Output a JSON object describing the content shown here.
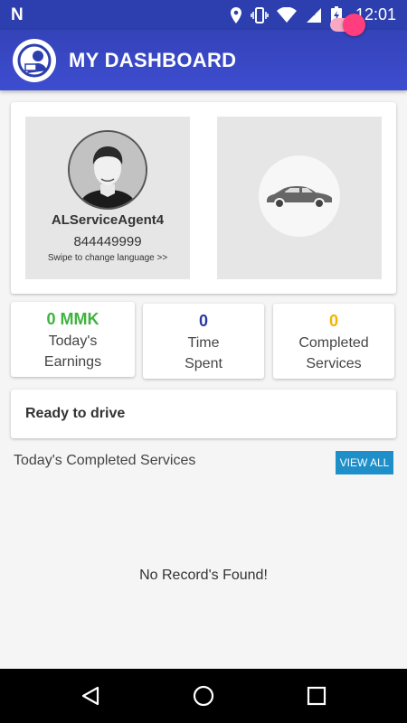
{
  "status_bar": {
    "time": "12:01",
    "left_icon": "n-notification-icon",
    "icons": [
      "location-icon",
      "vibrate-icon",
      "wifi-icon",
      "signal-roaming-icon",
      "battery-charging-icon"
    ]
  },
  "app_bar": {
    "title": "MY DASHBOARD",
    "logo_icon": "app-logo-icon"
  },
  "profile": {
    "name": "ALServiceAgent4",
    "phone": "844449999",
    "swipe_hint": "Swipe to change language >>",
    "vehicle_icon": "car-icon"
  },
  "stats": [
    {
      "value": "0 MMK",
      "label_line1": "Today's",
      "label_line2": "Earnings",
      "color": "#3fb33f"
    },
    {
      "value": "0",
      "label_line1": "Time",
      "label_line2": "Spent",
      "color": "#2a3a9e"
    },
    {
      "value": "0",
      "label_line1": "Completed",
      "label_line2": "Services",
      "color": "#f2b400"
    }
  ],
  "ready": {
    "label": "Ready to drive",
    "toggle_on": true,
    "accent": "#ff3d7f"
  },
  "completed_section": {
    "title": "Today's Completed Services",
    "view_all_label": "VIEW ALL",
    "empty_message": "No Record's Found!"
  },
  "nav": {
    "back_icon": "back-triangle-icon",
    "home_icon": "home-circle-icon",
    "recents_icon": "recents-square-icon"
  }
}
